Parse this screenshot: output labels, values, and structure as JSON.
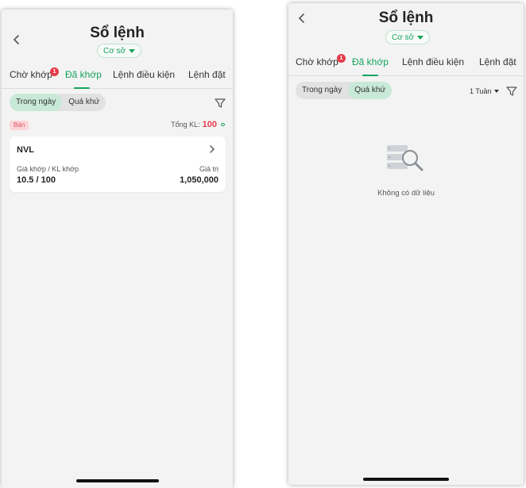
{
  "left": {
    "title": "Sổ lệnh",
    "market_select": "Cơ sở",
    "tabs": [
      {
        "label": "Chờ khớp",
        "badge": "1"
      },
      {
        "label": "Đã khớp"
      },
      {
        "label": "Lệnh điều kiện"
      },
      {
        "label": "Lệnh đặt"
      }
    ],
    "segments": [
      "Trong ngày",
      "Quá khứ"
    ],
    "side_label": "Bán",
    "total_label": "Tổng KL:",
    "total_value": "100",
    "order": {
      "symbol": "NVL",
      "price_qty_label": "Giá khớp / KL khớp",
      "price_qty_value": "10.5 / 100",
      "value_label": "Giá trị",
      "value_value": "1,050,000"
    }
  },
  "right": {
    "title": "Sổ lệnh",
    "market_select": "Cơ sở",
    "tabs": [
      {
        "label": "Chờ khớp",
        "badge": "1"
      },
      {
        "label": "Đã khớp"
      },
      {
        "label": "Lệnh điều kiện"
      },
      {
        "label": "Lệnh đặt"
      }
    ],
    "segments": [
      "Trong ngày",
      "Quá khứ"
    ],
    "period": "1 Tuần",
    "empty_message": "Không có dữ liệu"
  },
  "colors": {
    "accent": "#16a35e",
    "badge": "#e43b4a",
    "sell_bg": "#fbd5d8",
    "sell_text": "#e0535e"
  }
}
